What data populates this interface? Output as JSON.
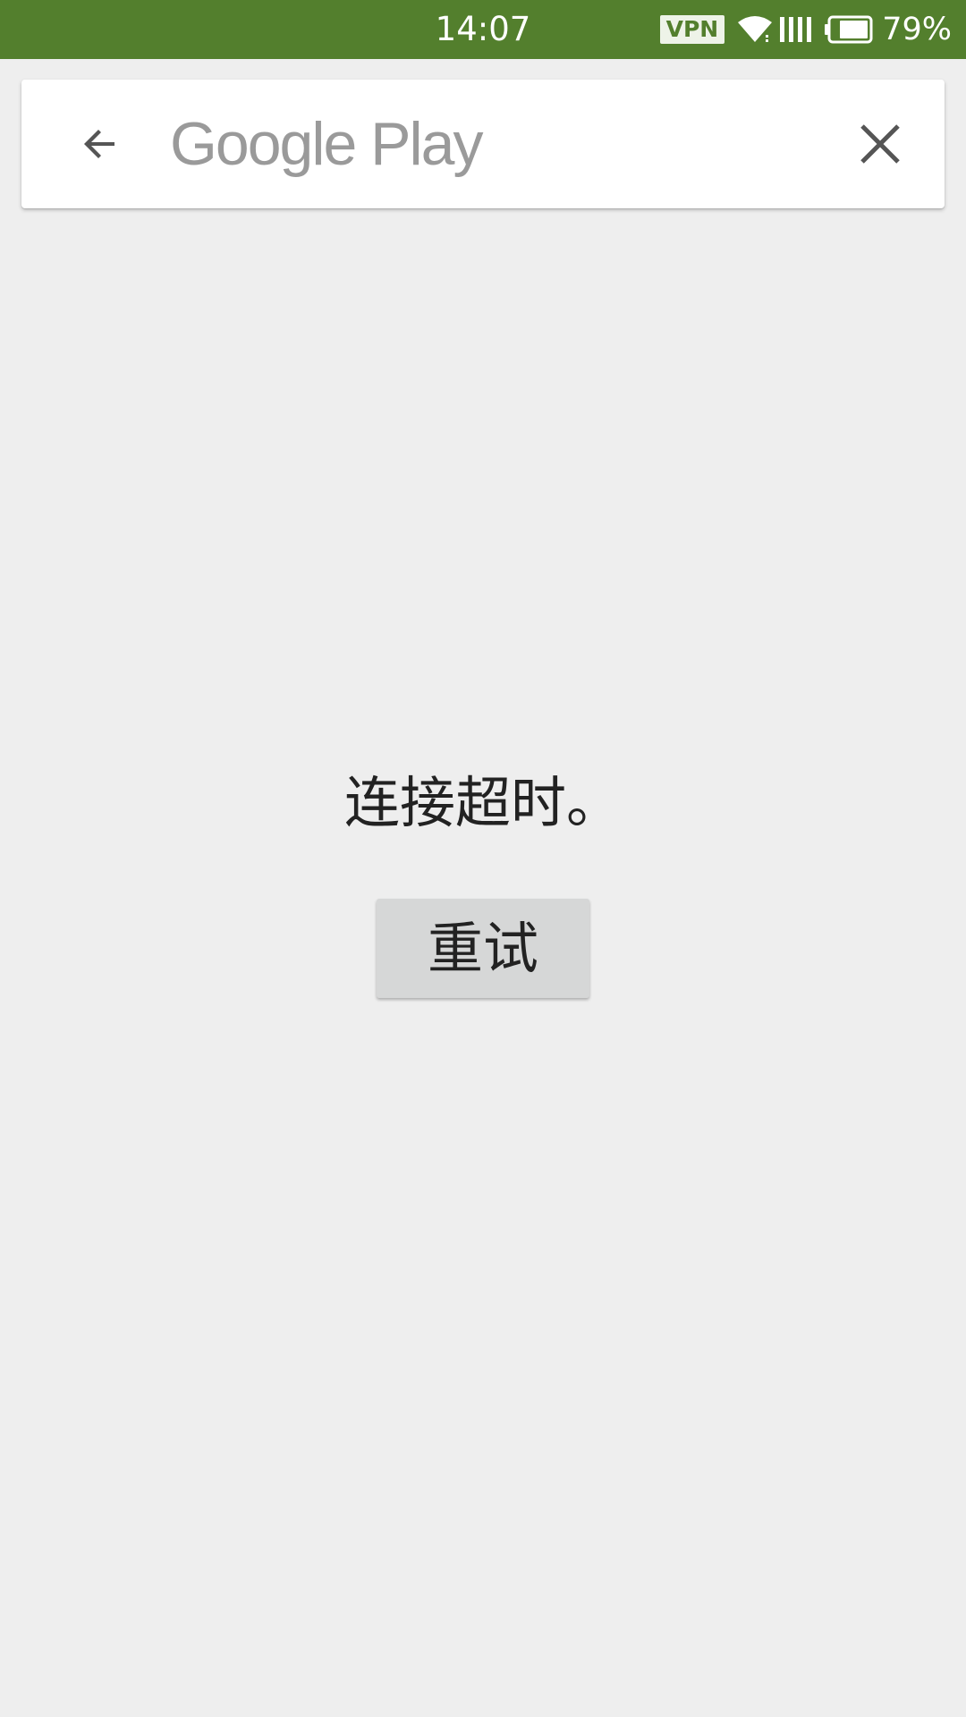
{
  "status_bar": {
    "time": "14:07",
    "vpn_label": "VPN",
    "battery_percent": "79%",
    "battery_level": 0.79,
    "background_color": "#537f2d",
    "icons": [
      "wifi-icon",
      "signal-icon",
      "battery-icon"
    ]
  },
  "search_bar": {
    "back_icon": "arrow-left-icon",
    "logo_text": "Google Play",
    "close_icon": "close-icon"
  },
  "content": {
    "error_message": "连接超时。",
    "retry_label": "重试"
  }
}
